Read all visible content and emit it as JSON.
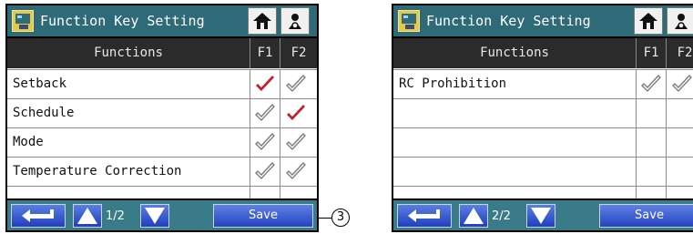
{
  "callout": {
    "number": "3"
  },
  "panels": [
    {
      "title": "Function Key Setting",
      "header": {
        "functions": "Functions",
        "f1": "F1",
        "f2": "F2"
      },
      "rows": [
        {
          "label": "Setback",
          "f1": true,
          "f2": false
        },
        {
          "label": "Schedule",
          "f1": false,
          "f2": true
        },
        {
          "label": "Mode",
          "f1": false,
          "f2": false
        },
        {
          "label": "Temperature Correction",
          "f1": false,
          "f2": false
        }
      ],
      "page_indicator": "1/2",
      "save_label": "Save"
    },
    {
      "title": "Function Key Setting",
      "header": {
        "functions": "Functions",
        "f1": "F1",
        "f2": "F2"
      },
      "rows": [
        {
          "label": "RC Prohibition",
          "f1": false,
          "f2": false
        },
        {
          "label": "",
          "f1": null,
          "f2": null
        },
        {
          "label": "",
          "f1": null,
          "f2": null
        },
        {
          "label": "",
          "f1": null,
          "f2": null
        }
      ],
      "page_indicator": "2/2",
      "save_label": "Save"
    }
  ],
  "icons": {
    "app": "function-key-app-icon",
    "home": "home-icon",
    "settings": "settings-icon",
    "back": "return-arrow-icon",
    "up": "arrow-up-icon",
    "down": "arrow-down-icon",
    "checked": "red-checkmark-icon",
    "unchecked": "outline-checkmark-icon"
  },
  "colors": {
    "titlebar": "#2e6a78",
    "bottombar": "#3a7b8a",
    "checked": "#c8202a",
    "button": "#2a48c8"
  }
}
